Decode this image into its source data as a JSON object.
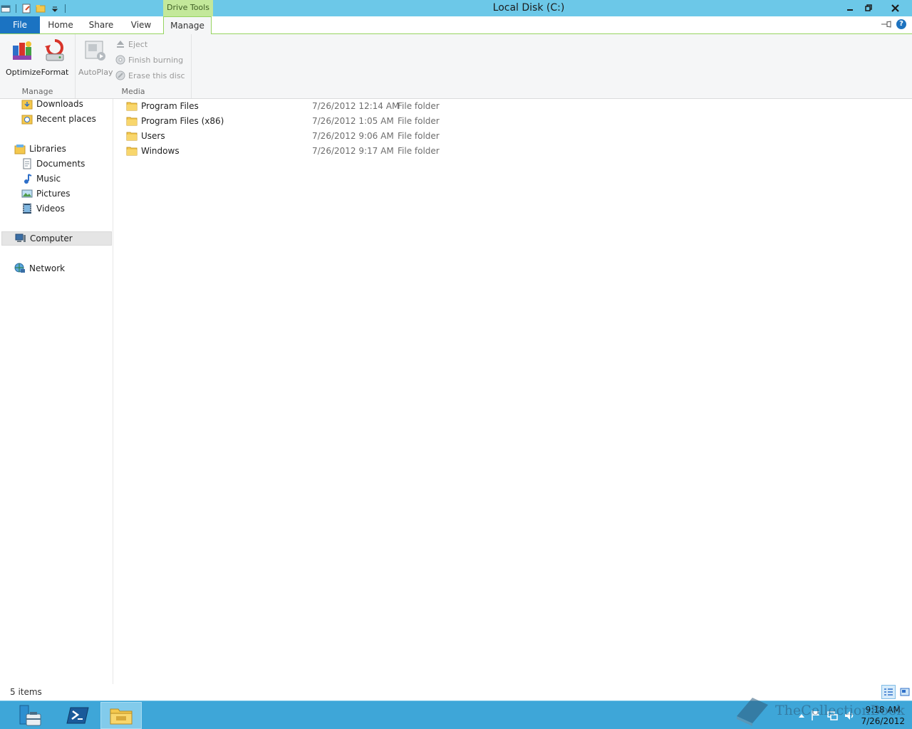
{
  "window": {
    "title": "Local Disk (C:)",
    "context_tab_group": "Drive Tools"
  },
  "tabs": {
    "file": "File",
    "home": "Home",
    "share": "Share",
    "view": "View",
    "manage": "Manage"
  },
  "ribbon": {
    "manage_group": {
      "label": "Manage",
      "optimize": "Optimize",
      "format": "Format"
    },
    "media_group": {
      "label": "Media",
      "autoplay": "AutoPlay",
      "eject": "Eject",
      "finish_burning": "Finish burning",
      "erase_disc": "Erase this disc"
    }
  },
  "nav": {
    "downloads": "Downloads",
    "recent_places": "Recent places",
    "libraries": "Libraries",
    "documents": "Documents",
    "music": "Music",
    "pictures": "Pictures",
    "videos": "Videos",
    "computer": "Computer",
    "network": "Network"
  },
  "files": [
    {
      "name": "Program Files",
      "date": "7/26/2012 12:14 AM",
      "type": "File folder"
    },
    {
      "name": "Program Files (x86)",
      "date": "7/26/2012 1:05 AM",
      "type": "File folder"
    },
    {
      "name": "Users",
      "date": "7/26/2012 9:06 AM",
      "type": "File folder"
    },
    {
      "name": "Windows",
      "date": "7/26/2012 9:17 AM",
      "type": "File folder"
    }
  ],
  "status": {
    "item_count": "5 items"
  },
  "taskbar": {
    "time": "9:18 AM",
    "date": "7/26/2012",
    "watermark": "TheCollectionBook"
  },
  "colors": {
    "titlebar": "#6cc8e8",
    "file_tab": "#1b73c2",
    "context_tab": "#c3e89a",
    "taskbar": "#3ea6d8"
  }
}
